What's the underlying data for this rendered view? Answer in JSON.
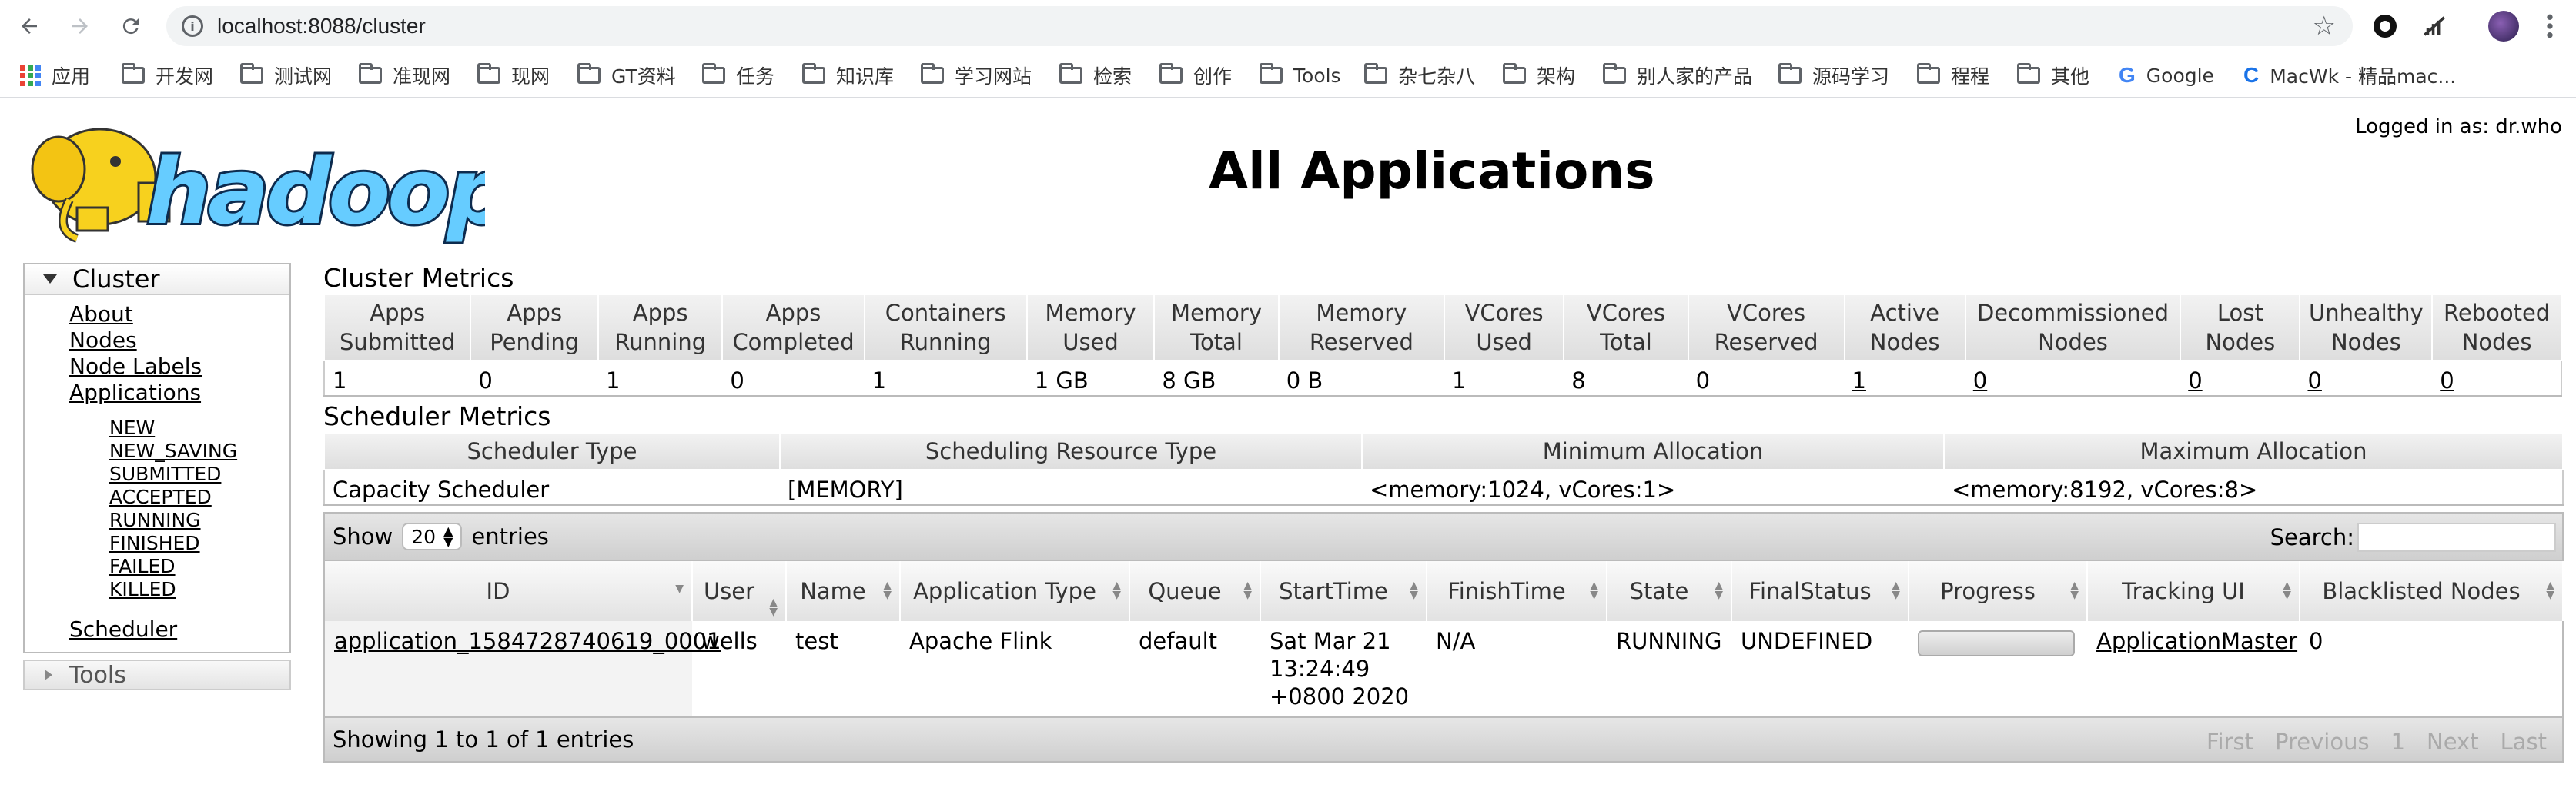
{
  "browser": {
    "url": "localhost:8088/cluster",
    "bookmarks": [
      "应用",
      "开发网",
      "测试网",
      "准现网",
      "现网",
      "GT资料",
      "任务",
      "知识库",
      "学习网站",
      "检索",
      "创作",
      "Tools",
      "杂七杂八",
      "架构",
      "别人家的产品",
      "源码学习",
      "程程",
      "其他",
      "Google",
      "MacWk - 精品mac..."
    ]
  },
  "header": {
    "logged_in": "Logged in as: dr.who",
    "title": "All Applications",
    "logo_text": "hadoop"
  },
  "sidebar": {
    "cluster_label": "Cluster",
    "links": [
      "About",
      "Nodes",
      "Node Labels",
      "Applications"
    ],
    "app_states": [
      "NEW",
      "NEW_SAVING",
      "SUBMITTED",
      "ACCEPTED",
      "RUNNING",
      "FINISHED",
      "FAILED",
      "KILLED"
    ],
    "scheduler": "Scheduler",
    "tools_label": "Tools"
  },
  "cluster_metrics": {
    "title": "Cluster Metrics",
    "headers": [
      "Apps Submitted",
      "Apps Pending",
      "Apps Running",
      "Apps Completed",
      "Containers Running",
      "Memory Used",
      "Memory Total",
      "Memory Reserved",
      "VCores Used",
      "VCores Total",
      "VCores Reserved",
      "Active Nodes",
      "Decommissioned Nodes",
      "Lost Nodes",
      "Unhealthy Nodes",
      "Rebooted Nodes"
    ],
    "values": [
      "1",
      "0",
      "1",
      "0",
      "1",
      "1 GB",
      "8 GB",
      "0 B",
      "1",
      "8",
      "0",
      "1",
      "0",
      "0",
      "0",
      "0"
    ]
  },
  "scheduler_metrics": {
    "title": "Scheduler Metrics",
    "headers": [
      "Scheduler Type",
      "Scheduling Resource Type",
      "Minimum Allocation",
      "Maximum Allocation"
    ],
    "values": [
      "Capacity Scheduler",
      "[MEMORY]",
      "<memory:1024, vCores:1>",
      "<memory:8192, vCores:8>"
    ]
  },
  "apps_table": {
    "show_label": "Show",
    "entries_value": "20",
    "entries_label": "entries",
    "search_label": "Search:",
    "columns": [
      "ID",
      "User",
      "Name",
      "Application Type",
      "Queue",
      "StartTime",
      "FinishTime",
      "State",
      "FinalStatus",
      "Progress",
      "Tracking UI",
      "Blacklisted Nodes"
    ],
    "rows": [
      {
        "id": "application_1584728740619_0001",
        "user": "wells",
        "name": "test",
        "type": "Apache Flink",
        "queue": "default",
        "start": [
          "Sat Mar 21",
          "13:24:49",
          "+0800 2020"
        ],
        "finish": "N/A",
        "state": "RUNNING",
        "final_status": "UNDEFINED",
        "progress": 0,
        "tracking": "ApplicationMaster",
        "blacklisted": "0"
      }
    ],
    "footer_info": "Showing 1 to 1 of 1 entries",
    "pager": [
      "First",
      "Previous",
      "1",
      "Next",
      "Last"
    ]
  }
}
